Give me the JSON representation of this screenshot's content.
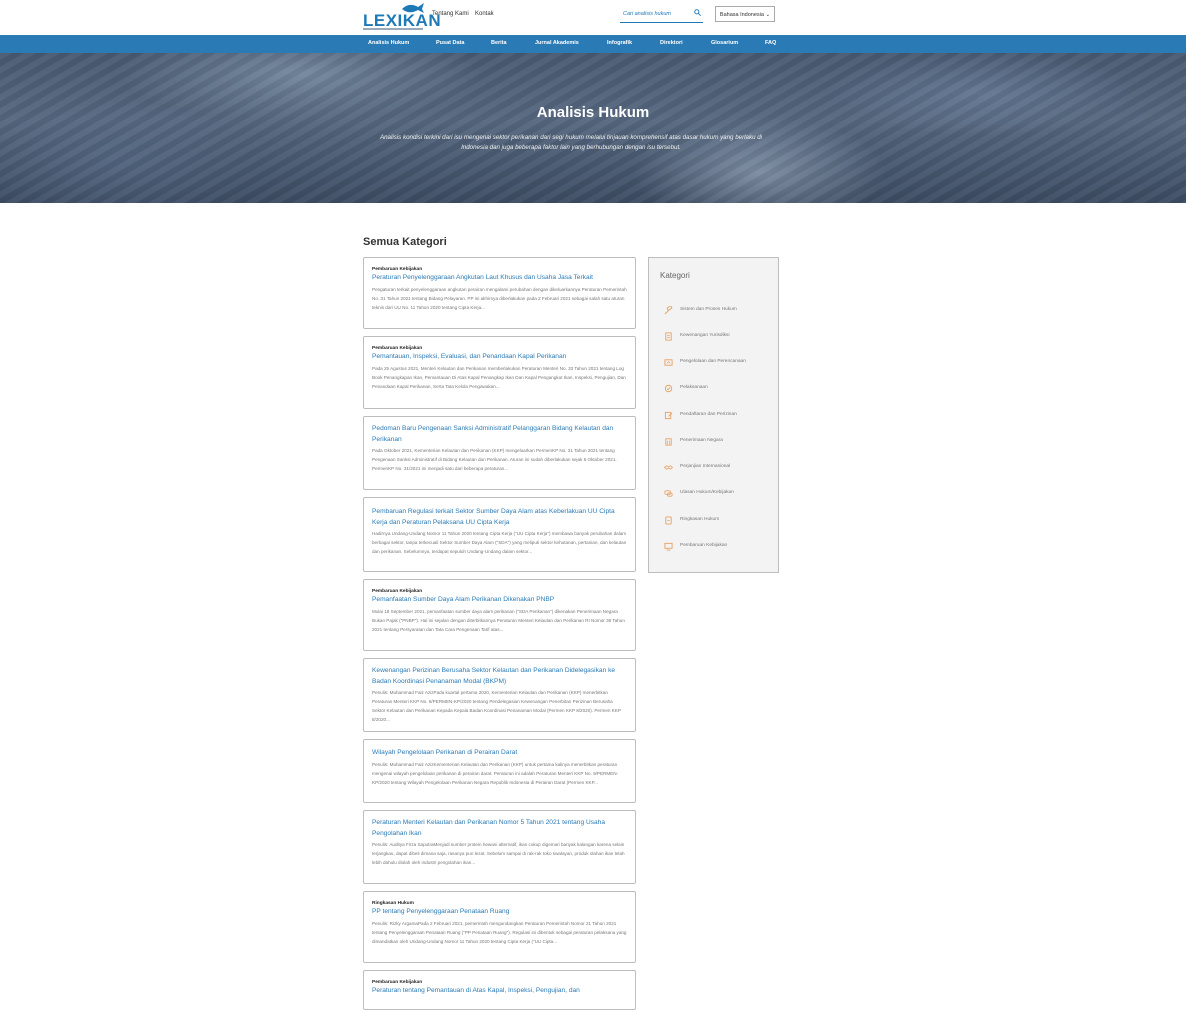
{
  "header": {
    "logo_text": "LEXIKAN",
    "links": [
      "Tentang Kami",
      "Kontak"
    ],
    "search_placeholder": "Cari analisis hukum",
    "language": "Bahasa Indonesia ⌄"
  },
  "nav": [
    "Analisis Hukum",
    "Pusat Data",
    "Berita",
    "Jurnal Akademis",
    "Infografik",
    "Direktori",
    "Glosarium",
    "FAQ"
  ],
  "hero": {
    "title": "Analisis Hukum",
    "description": "Analisis kondisi terkini dari isu mengenai sektor perikanan dari segi hukum melalui tinjauan komprehensif atas dasar hukum yang berlaku di Indonesia dan juga beberapa faktor lain yang berhubungan dengan isu tersebut."
  },
  "section_title": "Semua Kategori",
  "articles": [
    {
      "category": "Pembaruan Kebijakan",
      "title": "Peraturan Penyelenggaraan Angkutan Laut Khusus dan Usaha Jasa Terkait",
      "excerpt": "Pengaturan terkait penyelenggaraan angkutan perairan mengalami perubahan dengan dikeluarkannya Peraturan Pemerintah No. 31 Tahun 2021 tentang Bidang Pelayaran. PP ini akhirnya diberlakukan pada 2 Februari 2021 sebagai salah satu aturan teknis dari UU No. 11 Tahun 2020 tentang Cipta Kerja..."
    },
    {
      "category": "Pembaruan Kebijakan",
      "title": "Pemantauan, Inspeksi, Evaluasi, dan Penandaan Kapal Perikanan",
      "excerpt": "Pada 25 Agustus 2021, Menteri Kelautan dan Perikanan memberlakukan Peraturan Menteri No. 33 Tahun 2021 tentang Log Book Penangkapan Ikan, Pemantauan Di Atas Kapal Penangkap Ikan Dan Kapal Pengangkut Ikan, Inspeksi, Pengujian, Dan Penandaan Kapal Perikanan, Serta Tata Kelola Pengawakan..."
    },
    {
      "category": "",
      "title": "Pedoman Baru Pengenaan Sanksi Administratif Pelanggaran Bidang Kelautan dan Perikanan",
      "excerpt": "Pada Oktober 2021, Kementerian Kelautan dan Perikanan (KKP) mengeluarkan PermenKP No. 31 Tahun 2021 tentang Pengenaan Sanksi Administratif di Bidang Kelautan dan Perikanan. Aturan ini sudah diberlakukan sejak 6 Oktober 2021. PermenKP No. 31/2021 ini menjadi satu dari beberapa peraturan..."
    },
    {
      "category": "",
      "title": "Pembaruan Regulasi terkait Sektor Sumber Daya Alam atas Keberlakuan UU Cipta Kerja dan Peraturan Pelaksana UU Cipta Kerja",
      "excerpt": "Hadirnya Undang-Undang Nomor 11 Tahun 2020 tentang Cipta Kerja (\"UU Cipta Kerja\") membawa banyak perubahan dalam berbagai sektor, tanpa terkecuali Sektor Sumber Daya Alam (\"SDA\") yang meliputi sektor kehutanan, pertanian, dan kelautan dan perikanan. Sebelumnya, terdapat sepuluh Undang-Undang dalam sektor..."
    },
    {
      "category": "Pembaruan Kebijakan",
      "title": "Pemanfaatan Sumber Daya Alam Perikanan Dikenakan PNBP",
      "excerpt": "Mulai 18 September 2021, pemanfaatan sumber daya alam perikanan (\"SDA Perikanan\") dikenakan Penerimaan Negara Bukan Pajak (\"PNBP\"). Hal ini sejalan dengan diterbitkannya Peraturan Menteri Kelautan dan Perikanan RI Nomor 38 Tahun 2021 tentang Persyaratan dan Tata Cara Pengenaan Tarif atas..."
    },
    {
      "category": "",
      "title": "Kewenangan Perizinan Berusaha Sektor Kelautan dan Perikanan Didelegasikan ke Badan Koordinasi Penanaman Modal (BKPM)",
      "excerpt": "Penulis: Muhammad Faiz AzizPada kuartal pertama 2020, Kementerian Kelautan dan Perikanan (KKP) menerbitkan Peraturan Menteri KKP No. 8/PERMEN-KP/2020 tentang Pendelegasian Kewenangan Penerbitan Perizinan Berusaha Sektor Kelautan dan Perikanan Kepada Kepala Badan Koordinasi Penanaman Modal (Permen KKP 8/2020). Permen KKP 8/2020..."
    },
    {
      "category": "",
      "title": "Wilayah Pengelolaan Perikanan di Perairan Darat",
      "excerpt": "Penulis: Muhammad Faiz AzizKementerian Kelautan dan Perikanan (KKP) untuk pertama kalinya menerbitkan peraturan mengenai wilayah pengelolaan perikanan di perairan darat. Peraturan ini adalah Peraturan Menteri KKP No. 9/PERMEN-KP/2020 tentang Wilayah Pengelolaan Perikanan Negara Republik Indonesia di Perairan Darat (Permen KKP..."
    },
    {
      "category": "",
      "title": "Peraturan Menteri Kelautan dan Perikanan Nomor 5 Tahun 2021 tentang Usaha Pengolahan Ikan",
      "excerpt": "Penulis: Auditya Firza SaputraMenjadi sumber protein hewani alternatif, ikan cukup digemari banyak kalangan karena selain terjangkau, dapat dibeli dimana saja, rasanya pun lezat. Sebelum sampai di rak-rak toko swalayan, produk olahan ikan telah lebih dahulu diolah oleh industri pengolahan ikan..."
    },
    {
      "category": "Ringkasan Hukum",
      "title": "PP tentang Penyelenggaraan Penataan Ruang",
      "excerpt": "Penulis: Rizky ArgamaPada 2 Februari 2021, pemerintah mengundangkan Peraturan Pemerintah Nomor 21 Tahun 2021 tentang Penyelenggaraan Penataan Ruang (\"PP Penataan Ruang\"). Regulasi ini dibentuk sebagai peraturan pelaksana yang dimandatkan oleh Undang-Undang Nomor 11 Tahun 2020 tentang Cipta Kerja (\"UU Cipta..."
    },
    {
      "category": "Pembaruan Kebijakan",
      "title": "Peraturan tentang Pemantauan di Atas Kapal, Inspeksi, Pengujian, dan",
      "excerpt": ""
    }
  ],
  "sidebar": {
    "title": "Kategori",
    "items": [
      {
        "label": "Sistem dan Proses Hukum",
        "icon": "gavel-icon"
      },
      {
        "label": "Kewenangan Yurisdiksi",
        "icon": "document-icon"
      },
      {
        "label": "Pengelolaan dan Perencanaan",
        "icon": "planning-icon"
      },
      {
        "label": "Pelaksanaan",
        "icon": "check-circle-icon"
      },
      {
        "label": "Pendaftaran dan Perizinan",
        "icon": "edit-document-icon"
      },
      {
        "label": "Penerimaan Negara",
        "icon": "building-icon"
      },
      {
        "label": "Perjanjian Internasional",
        "icon": "handshake-icon"
      },
      {
        "label": "Ulasan Hukum/Kebijakan",
        "icon": "chat-icon"
      },
      {
        "label": "Ringkasan Hukum",
        "icon": "summary-icon"
      },
      {
        "label": "Pembaruan Kebijakan",
        "icon": "monitor-icon"
      }
    ]
  },
  "colors": {
    "accent": "#2a7ab5",
    "icon": "#e8a060"
  }
}
